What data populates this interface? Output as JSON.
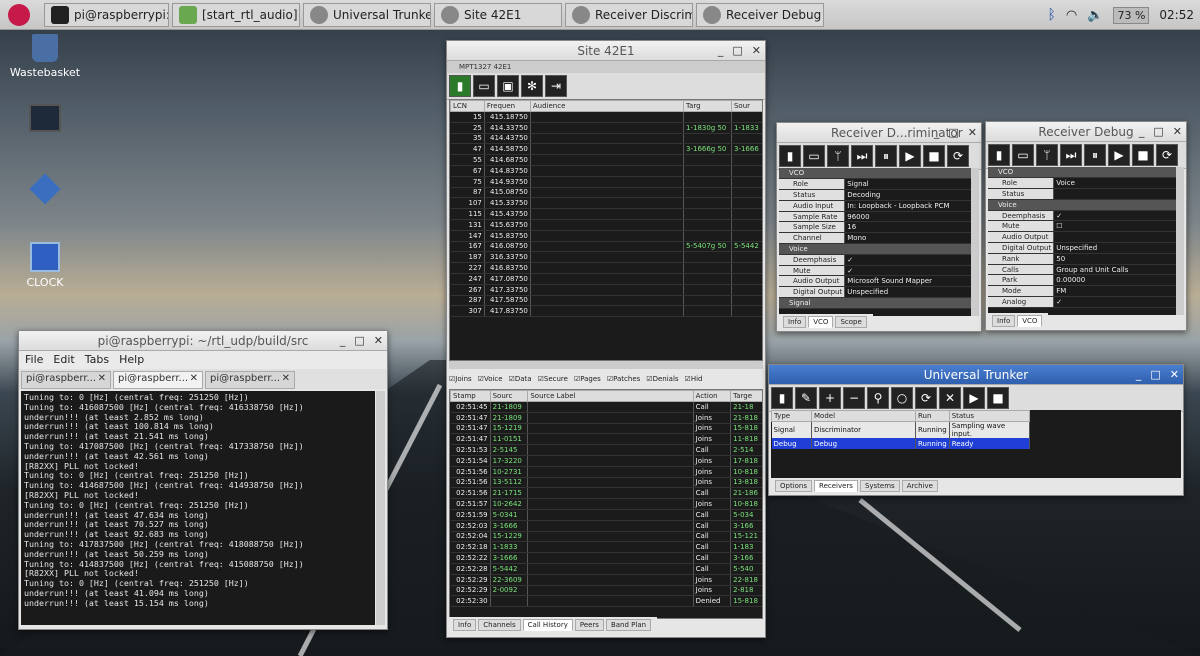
{
  "taskbar": {
    "terminal_title": "pi@raspberrypi: ~/rtl...",
    "script_title": "[start_rtl_audio]",
    "trunker_title": "Universal Trunker",
    "site_title": "Site 42E1",
    "discriminator_title": "Receiver Discriminator",
    "debug_title": "Receiver Debug",
    "volume": "73 %",
    "clock": "02:52"
  },
  "desktop": {
    "wastebasket": "Wastebasket",
    "clock": "CLOCK"
  },
  "site_window": {
    "title": "Site 42E1",
    "system_label": "MPT1327 42E1",
    "lcn_headers": [
      "LCN",
      "Frequen",
      "Audience",
      "Targ",
      "Sour"
    ],
    "lcn_rows": [
      [
        "15",
        "415.18750",
        "",
        "",
        ""
      ],
      [
        "25",
        "414.33750",
        "",
        "1-1830g 50",
        "1-1833"
      ],
      [
        "35",
        "414.43750",
        "",
        "",
        ""
      ],
      [
        "47",
        "414.58750",
        "",
        "3-1666g 50",
        "3-1666"
      ],
      [
        "55",
        "414.68750",
        "",
        "",
        ""
      ],
      [
        "67",
        "414.83750",
        "",
        "",
        ""
      ],
      [
        "75",
        "414.93750",
        "",
        "",
        ""
      ],
      [
        "87",
        "415.08750",
        "",
        "",
        ""
      ],
      [
        "107",
        "415.33750",
        "",
        "",
        ""
      ],
      [
        "115",
        "415.43750",
        "",
        "",
        ""
      ],
      [
        "131",
        "415.63750",
        "",
        "",
        ""
      ],
      [
        "147",
        "415.83750",
        "",
        "",
        ""
      ],
      [
        "167",
        "416.08750",
        "",
        "5-5407g 50",
        "5-5442"
      ],
      [
        "187",
        "316.33750",
        "",
        "",
        ""
      ],
      [
        "227",
        "416.83750",
        "",
        "",
        ""
      ],
      [
        "247",
        "417.08750",
        "",
        "",
        ""
      ],
      [
        "267",
        "417.33750",
        "",
        "",
        ""
      ],
      [
        "287",
        "417.58750",
        "",
        "",
        ""
      ],
      [
        "307",
        "417.83750",
        "",
        "",
        ""
      ]
    ],
    "filters": [
      "Joins",
      "Voice",
      "Data",
      "Secure",
      "Pages",
      "Patches",
      "Denials",
      "Hid"
    ],
    "event_headers": [
      "Stamp",
      "Sourc",
      "Source Label",
      "Action",
      "Targe"
    ],
    "event_rows": [
      [
        "02:51:45",
        "21-1809",
        "",
        "Call",
        "21-18"
      ],
      [
        "02:51:47",
        "21-1809",
        "",
        "Joins",
        "21-818"
      ],
      [
        "02:51:47",
        "15-1219",
        "",
        "Joins",
        "15-818"
      ],
      [
        "02:51:47",
        "11-0151",
        "",
        "Joins",
        "11-818"
      ],
      [
        "02:51:53",
        "2-5145",
        "",
        "Call",
        "2-514"
      ],
      [
        "02:51:54",
        "17-3220",
        "",
        "Joins",
        "17-818"
      ],
      [
        "02:51:56",
        "10-2731",
        "",
        "Joins",
        "10-818"
      ],
      [
        "02:51:56",
        "13-5112",
        "",
        "Joins",
        "13-818"
      ],
      [
        "02:51:56",
        "21-1715",
        "",
        "Call",
        "21-186"
      ],
      [
        "02:51:57",
        "10-2642",
        "",
        "Joins",
        "10-818"
      ],
      [
        "02:51:59",
        "5-0341",
        "",
        "Call",
        "5-034"
      ],
      [
        "02:52:03",
        "3-1666",
        "",
        "Call",
        "3-166"
      ],
      [
        "02:52:04",
        "15-1229",
        "",
        "Call",
        "15-121"
      ],
      [
        "02:52:18",
        "1-1833",
        "",
        "Call",
        "1-183"
      ],
      [
        "02:52:22",
        "3-1666",
        "",
        "Call",
        "3-166"
      ],
      [
        "02:52:28",
        "5-5442",
        "",
        "Call",
        "5-540"
      ],
      [
        "02:52:29",
        "22-3609",
        "",
        "Joins",
        "22-818"
      ],
      [
        "02:52:29",
        "2-0092",
        "",
        "Joins",
        "2-818"
      ],
      [
        "02:52:30",
        "",
        "",
        "Denied",
        "15-818"
      ]
    ],
    "tabs": [
      "Info",
      "Channels",
      "Call History",
      "Peers",
      "Band Plan"
    ]
  },
  "discriminator": {
    "title": "Receiver D...riminator",
    "rows": [
      [
        "VCO",
        ""
      ],
      [
        "Role",
        "Signal"
      ],
      [
        "Status",
        "Decoding"
      ],
      [
        "Audio Input",
        "In: Loopback - Loopback PCM"
      ],
      [
        "Sample Rate",
        "96000"
      ],
      [
        "Sample Size",
        "16"
      ],
      [
        "Channel",
        "Mono"
      ],
      [
        "Voice",
        ""
      ],
      [
        "Deemphasis",
        "✓"
      ],
      [
        "Mute",
        "✓"
      ],
      [
        "Audio Output",
        "Microsoft Sound Mapper"
      ],
      [
        "Digital Output",
        "Unspecified"
      ],
      [
        "Signal",
        ""
      ]
    ],
    "tabs": [
      "Info",
      "VCO",
      "Scope"
    ]
  },
  "debug": {
    "title": "Receiver Debug",
    "rows": [
      [
        "VCO",
        ""
      ],
      [
        "Role",
        "Voice"
      ],
      [
        "Status",
        ""
      ],
      [
        "Voice",
        ""
      ],
      [
        "Deemphasis",
        "✓"
      ],
      [
        "Mute",
        "☐"
      ],
      [
        "Audio Output",
        ""
      ],
      [
        "Digital Output",
        "Unspecified"
      ],
      [
        "Rank",
        "50"
      ],
      [
        "Calls",
        "Group and Unit Calls"
      ],
      [
        "Park",
        "0.00000"
      ],
      [
        "Mode",
        "FM"
      ],
      [
        "Analog",
        "✓"
      ]
    ],
    "tabs": [
      "Info",
      "VCO"
    ]
  },
  "trunker": {
    "title": "Universal Trunker",
    "headers": [
      "Type",
      "Model",
      "Run",
      "Status"
    ],
    "rows": [
      [
        "Signal",
        "Discriminator",
        "Running",
        "Sampling wave input."
      ],
      [
        "Debug",
        "Debug",
        "Running",
        "Ready"
      ]
    ],
    "tabs": [
      "Options",
      "Receivers",
      "Systems",
      "Archive"
    ]
  },
  "terminal": {
    "title": "pi@raspberrypi: ~/rtl_udp/build/src",
    "menu": [
      "File",
      "Edit",
      "Tabs",
      "Help"
    ],
    "tabs": [
      "pi@raspberr...",
      "pi@raspberr...",
      "pi@raspberr..."
    ],
    "lines": [
      "Tuning to: 0 [Hz] (central freq: 251250 [Hz])",
      "Tuning to: 416087500 [Hz] (central freq: 416338750 [Hz])",
      "underrun!!! (at least 2.852 ms long)",
      "underrun!!! (at least 100.814 ms long)",
      "underrun!!! (at least 21.541 ms long)",
      "Tuning to: 417087500 [Hz] (central freq: 417338750 [Hz])",
      "underrun!!! (at least 42.561 ms long)",
      "[R82XX] PLL not locked!",
      "Tuning to: 0 [Hz] (central freq: 251250 [Hz])",
      "Tuning to: 414687500 [Hz] (central freq: 414938750 [Hz])",
      "[R82XX] PLL not locked!",
      "Tuning to: 0 [Hz] (central freq: 251250 [Hz])",
      "underrun!!! (at least 47.634 ms long)",
      "underrun!!! (at least 70.527 ms long)",
      "underrun!!! (at least 92.683 ms long)",
      "Tuning to: 417837500 [Hz] (central freq: 418088750 [Hz])",
      "underrun!!! (at least 50.259 ms long)",
      "Tuning to: 414837500 [Hz] (central freq: 415088750 [Hz])",
      "[R82XX] PLL not locked!",
      "Tuning to: 0 [Hz] (central freq: 251250 [Hz])",
      "underrun!!! (at least 41.094 ms long)",
      "underrun!!! (at least 15.154 ms long)"
    ]
  }
}
